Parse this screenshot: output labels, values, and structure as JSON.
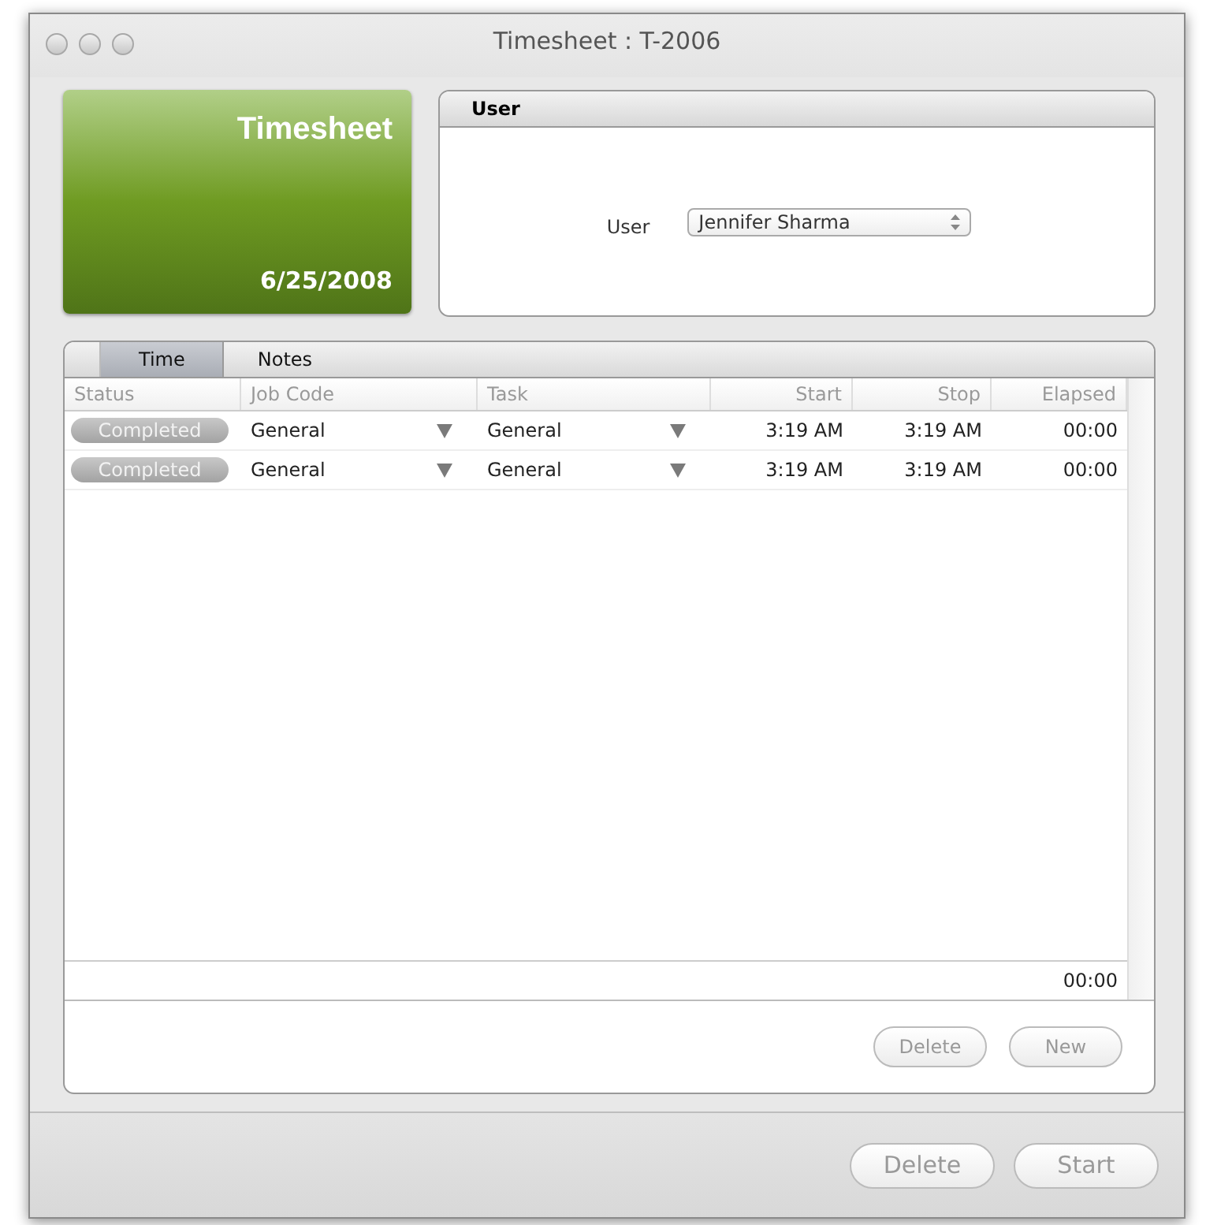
{
  "window": {
    "title": "Timesheet : T-2006"
  },
  "tile": {
    "title": "Timesheet",
    "date": "6/25/2008"
  },
  "user_panel": {
    "title": "User",
    "label": "User",
    "value": "Jennifer Sharma"
  },
  "tabs": [
    {
      "label": "Time",
      "selected": true
    },
    {
      "label": "Notes",
      "selected": false
    }
  ],
  "table": {
    "columns": [
      "Status",
      "Job Code",
      "Task",
      "Start",
      "Stop",
      "Elapsed"
    ],
    "rows": [
      {
        "status": "Completed",
        "job_code": "General",
        "task": "General",
        "start": "3:19 AM",
        "stop": "3:19 AM",
        "elapsed": "00:00"
      },
      {
        "status": "Completed",
        "job_code": "General",
        "task": "General",
        "start": "3:19 AM",
        "stop": "3:19 AM",
        "elapsed": "00:00"
      }
    ],
    "total": "00:00"
  },
  "panel_buttons": [
    {
      "label": "Delete",
      "disabled": true
    },
    {
      "label": "New",
      "disabled": true
    }
  ],
  "footer_buttons": [
    {
      "label": "Delete",
      "disabled": true
    },
    {
      "label": "Start",
      "disabled": true
    }
  ]
}
